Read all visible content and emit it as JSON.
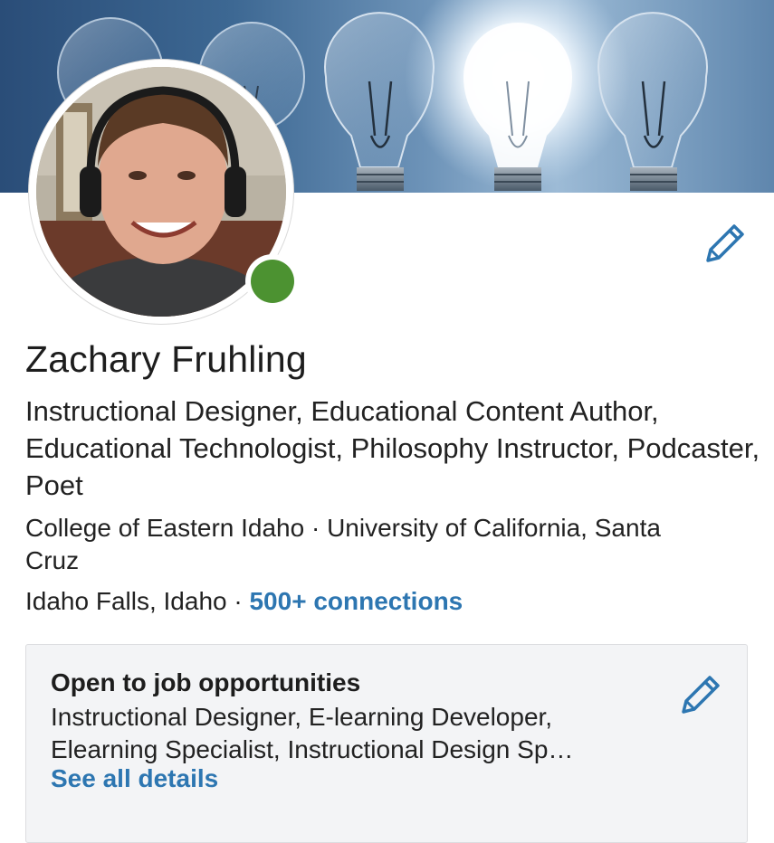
{
  "profile": {
    "name": "Zachary Fruhling",
    "headline": "Instructional Designer, Educational Content Author, Educational Technologist, Philosophy Instructor, Podcaster, Poet",
    "education": "College of Eastern Idaho · University of California, Santa Cruz",
    "location": "Idaho Falls, Idaho",
    "separator": " · ",
    "connections": "500+ connections",
    "online": true
  },
  "job_card": {
    "title": "Open to job opportunities",
    "description": "Instructional Designer, E-learning Developer, Elearning Specialist, Instructional Design Sp…",
    "link": "See all details"
  },
  "icons": {
    "profile_edit": "pencil-icon",
    "job_edit": "pencil-icon",
    "banner": "light-bulbs-background"
  },
  "colors": {
    "accent": "#2d76b1",
    "online_dot": "#4c9231",
    "card_bg": "#f3f4f6",
    "banner_dark": "#2a4d78"
  }
}
